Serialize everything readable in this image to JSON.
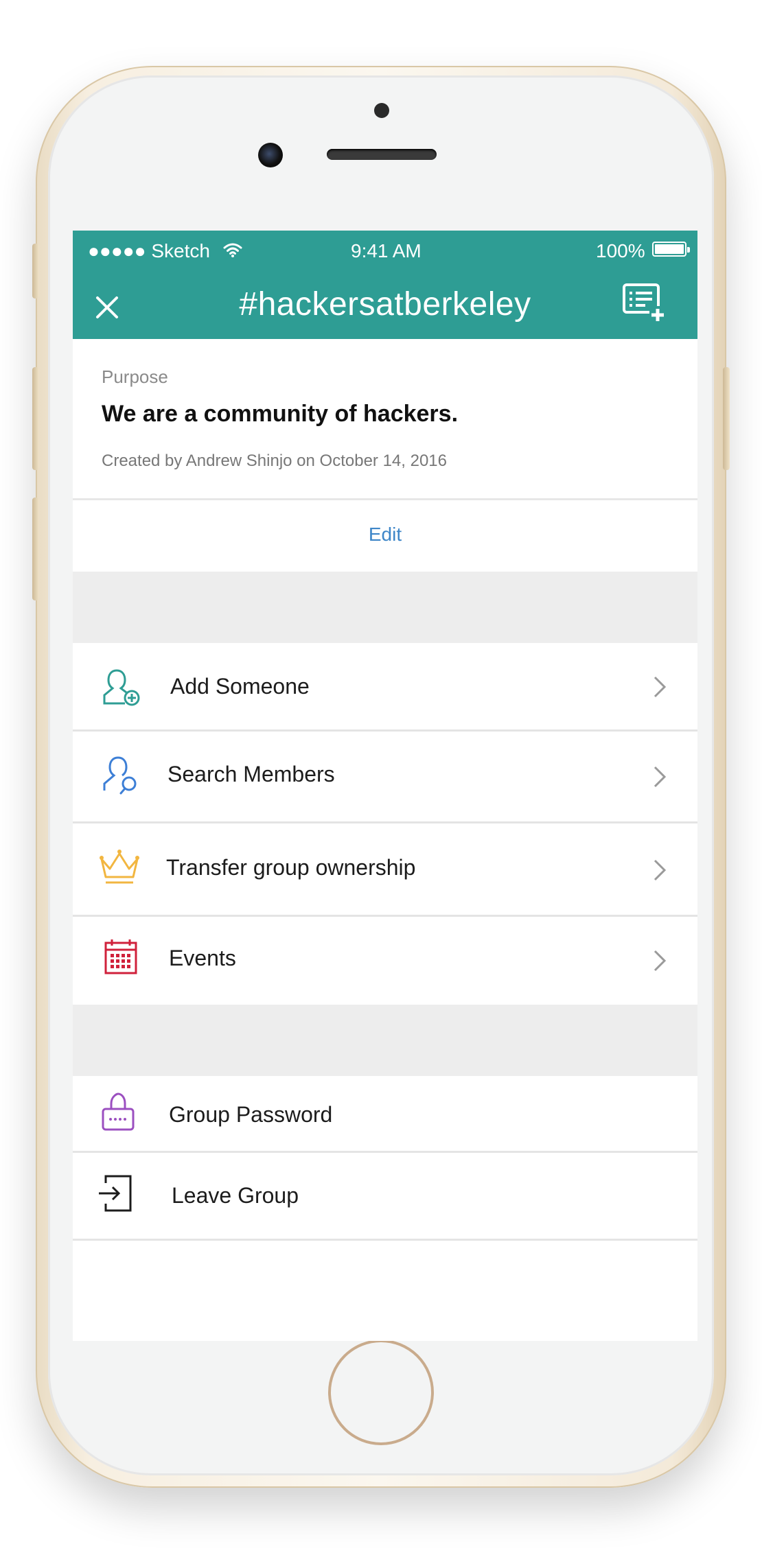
{
  "status_bar": {
    "carrier": "●●●●● Sketch",
    "time": "9:41 AM",
    "battery": "100%"
  },
  "header": {
    "title": "#hackersatberkeley",
    "close_icon": "close-icon",
    "compose_icon": "new-list-icon"
  },
  "purpose": {
    "label": "Purpose",
    "text": "We are a community of hackers.",
    "meta": "Created by Andrew Shinjo on October 14, 2016"
  },
  "edit": {
    "label": "Edit"
  },
  "menu": [
    {
      "label": "Add Someone",
      "icon": "add-person-icon",
      "color": "#2e9d94"
    },
    {
      "label": "Search Members",
      "icon": "search-person-icon",
      "color": "#3d7fd6"
    },
    {
      "label": "Transfer group ownership",
      "icon": "crown-icon",
      "color": "#f2b640"
    },
    {
      "label": "Events",
      "icon": "calendar-icon",
      "color": "#d0213b"
    }
  ],
  "secondary_menu": [
    {
      "label": "Group Password",
      "icon": "lock-icon",
      "color": "#9b4fc0"
    },
    {
      "label": "Leave Group",
      "icon": "exit-icon",
      "color": "#1c1c1c"
    }
  ],
  "colors": {
    "accent": "#2e9d94",
    "link": "#3e86c8",
    "background": "#ededed"
  }
}
